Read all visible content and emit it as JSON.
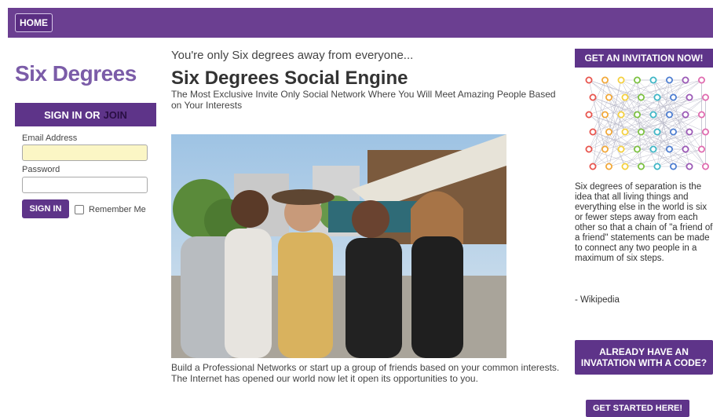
{
  "nav": {
    "home_label": "HOME"
  },
  "sidebar": {
    "brand": "Six Degrees",
    "signin_heading": "SIGN IN OR",
    "join_label": "JOIN",
    "email_label": "Email Address",
    "email_value": "",
    "password_label": "Password",
    "password_value": "",
    "signin_button": "SIGN IN",
    "remember_label": "Remember Me"
  },
  "main": {
    "tagline": "You're only Six degrees away from everyone...",
    "title": "Six Degrees Social Engine",
    "subtitle": "The Most Exclusive Invite Only Social Network Where You Will Meet Amazing People Based on Your Interests",
    "caption": "Build a Professional Networks or start up a group of friends based on your common interests. The Internet has opened our world now let it open its opportunities to you."
  },
  "right": {
    "invite_button": "GET AN INVITATION NOW!",
    "wiki_text": "Six degrees of separation is the idea that all living things and everything else in the world is six or fewer steps away from each other so that a chain of \"a friend of a friend\" statements can be made to connect any two people in a maximum of six steps.",
    "wiki_source": "- Wikipedia",
    "code_button": "ALREADY HAVE AN INVATATION WITH A CODE?",
    "started_button": "GET STARTED HERE!"
  },
  "colors": {
    "brand_purple": "#5e3489",
    "brand_light": "#7b5ca8",
    "nav_bg": "#6b3f91",
    "email_field_bg": "#fbf6c5"
  },
  "icons": {
    "network": "network-graph-icon",
    "photo": "group-photo"
  }
}
